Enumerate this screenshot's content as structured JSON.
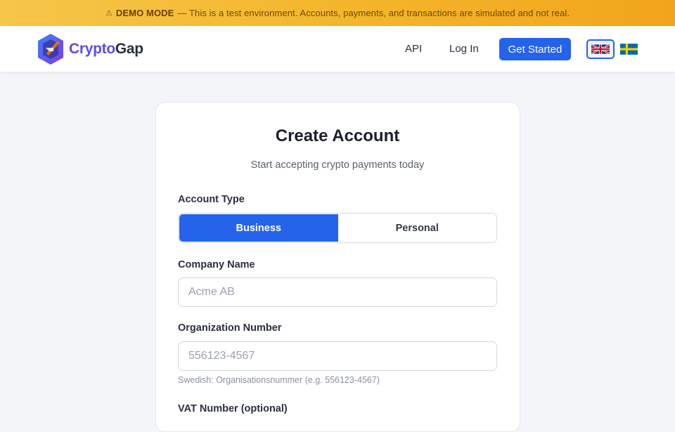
{
  "banner": {
    "icon": "warning-icon",
    "mode_label": "DEMO MODE",
    "message": "— This is a test environment. Accounts, payments, and transactions are simulated and not real."
  },
  "header": {
    "logo_part1": "Crypto",
    "logo_part2": "Gap",
    "nav": {
      "api": "API",
      "login": "Log In"
    },
    "cta": "Get Started",
    "languages": [
      {
        "icon": "uk-flag-icon",
        "selected": true
      },
      {
        "icon": "sweden-flag-icon",
        "selected": false
      }
    ]
  },
  "form": {
    "title": "Create Account",
    "subtitle": "Start accepting crypto payments today",
    "account_type": {
      "label": "Account Type",
      "options": [
        "Business",
        "Personal"
      ],
      "selected": "Business"
    },
    "company_name": {
      "label": "Company Name",
      "placeholder": "Acme AB"
    },
    "org_number": {
      "label": "Organization Number",
      "placeholder": "556123-4567",
      "hint": "Swedish: Organisationsnummer (e.g. 556123-4567)"
    },
    "vat_number": {
      "label": "VAT Number (optional)"
    }
  },
  "colors": {
    "accent": "#2563eb",
    "banner": "#f4b62c",
    "logo_accent": "#5b4fe0"
  }
}
